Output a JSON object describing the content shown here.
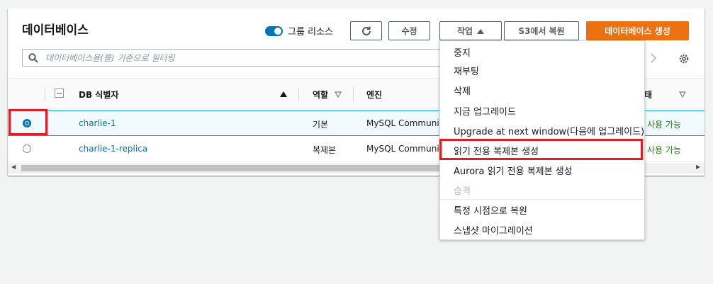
{
  "panel": {
    "title": "데이터베이스",
    "toggle_label": "그룹 리소스",
    "buttons": {
      "modify": "수정",
      "actions": "작업",
      "restore_s3": "S3에서 복원",
      "create_db": "데이터베이스 생성"
    },
    "search_placeholder": "데이터베이스을(를) 기준으로 필터링"
  },
  "table": {
    "headers": {
      "db_id": "DB 식별자",
      "role": "역할",
      "engine": "엔진",
      "status": "태"
    },
    "rows": [
      {
        "id": "charlie-1",
        "role": "기본",
        "engine": "MySQL Communit",
        "status": "사용 가능",
        "selected": true
      },
      {
        "id": "charlie-1-replica",
        "role": "복제본",
        "engine": "MySQL Communit",
        "status": "사용 가능",
        "selected": false
      }
    ]
  },
  "actions_menu": {
    "items": [
      {
        "label": "중지",
        "disabled": false
      },
      {
        "label": "재부팅",
        "disabled": false
      },
      {
        "label": "삭제",
        "disabled": false
      },
      {
        "label": "지금 업그레이드",
        "disabled": false
      },
      {
        "label": "Upgrade at next window(다음에 업그레이드)",
        "disabled": false
      },
      {
        "label": "읽기 전용 복제본 생성",
        "disabled": false,
        "highlighted": true
      },
      {
        "label": "Aurora 읽기 전용 복제본 생성",
        "disabled": false
      },
      {
        "label": "승격",
        "disabled": true
      },
      {
        "label": "특정 시점으로 복원",
        "disabled": false
      },
      {
        "label": "스냅샷 마이그레이션",
        "disabled": false
      }
    ]
  },
  "colors": {
    "primary_orange": "#ec7211",
    "link_blue": "#0073bb",
    "status_green": "#1d8102",
    "annotation_red": "#e31b23"
  },
  "icons": [
    "refresh-icon",
    "search-icon",
    "gear-icon",
    "caret-up-icon",
    "sort-asc-icon",
    "sort-desc-icon",
    "chevron-right-icon"
  ]
}
